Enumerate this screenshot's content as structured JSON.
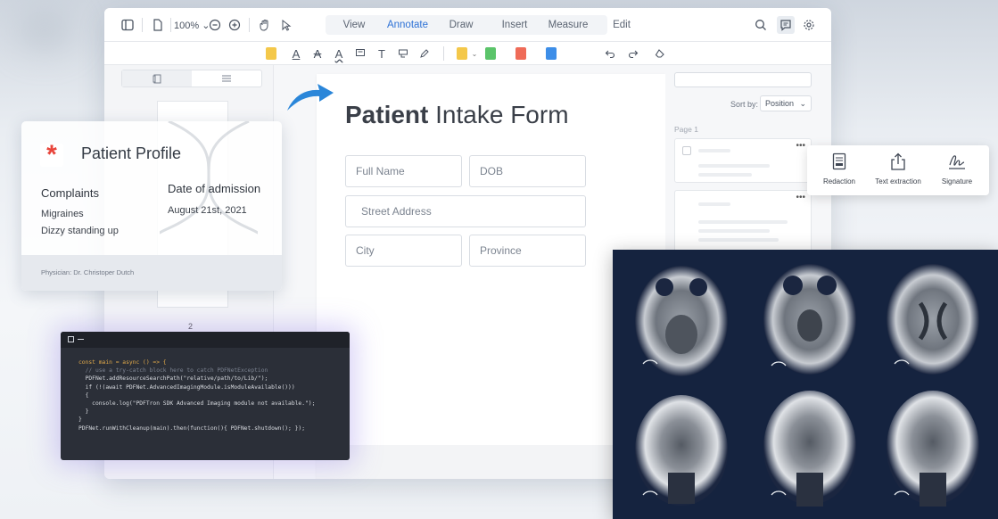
{
  "toolbar": {
    "zoom": "100%",
    "tabs": [
      "View",
      "Annotate",
      "Draw",
      "Insert",
      "Measure",
      "Edit"
    ],
    "active_tab": "Annotate"
  },
  "left_panel": {
    "page_number": "2"
  },
  "document": {
    "title_bold": "Patient",
    "title_rest": "Intake Form",
    "fields": {
      "full_name": "Full Name",
      "dob": "DOB",
      "street": "Street Address",
      "city": "City",
      "province": "Province"
    }
  },
  "right_panel": {
    "sort_label": "Sort by:",
    "sort_value": "Position",
    "page_label": "Page 1",
    "more": "•••"
  },
  "features": {
    "items": [
      {
        "label": "Redaction",
        "icon": "redaction-icon"
      },
      {
        "label": "Text extraction",
        "icon": "share-icon"
      },
      {
        "label": "Signature",
        "icon": "signature-icon"
      }
    ]
  },
  "profile": {
    "title": "Patient Profile",
    "complaints_label": "Complaints",
    "complaints": [
      "Migraines",
      "Dizzy standing up"
    ],
    "admission_label": "Date of admission",
    "admission_date": "August 21st, 2021",
    "physician": "Physician: Dr. Christoper Dutch"
  },
  "code": {
    "lines": [
      "const main = async () => {",
      "  // use a try-catch block here to catch PDFNetException",
      "  PDFNet.addResourceSearchPath(\"relative/path/to/Lib/\");",
      "  if (!(await PDFNet.AdvancedImagingModule.isModuleAvailable()))",
      "  {",
      "    console.log(\"PDFTron SDK Advanced Imaging module not available.\");",
      "  }",
      "}",
      "PDFNet.runWithCleanup(main).then(function(){ PDFNet.shutdown(); });"
    ]
  },
  "colors": {
    "accent": "#2f72d6",
    "asterisk": "#e8443a",
    "mri_bg": "#15233f",
    "code_bg": "#2b2f38"
  }
}
